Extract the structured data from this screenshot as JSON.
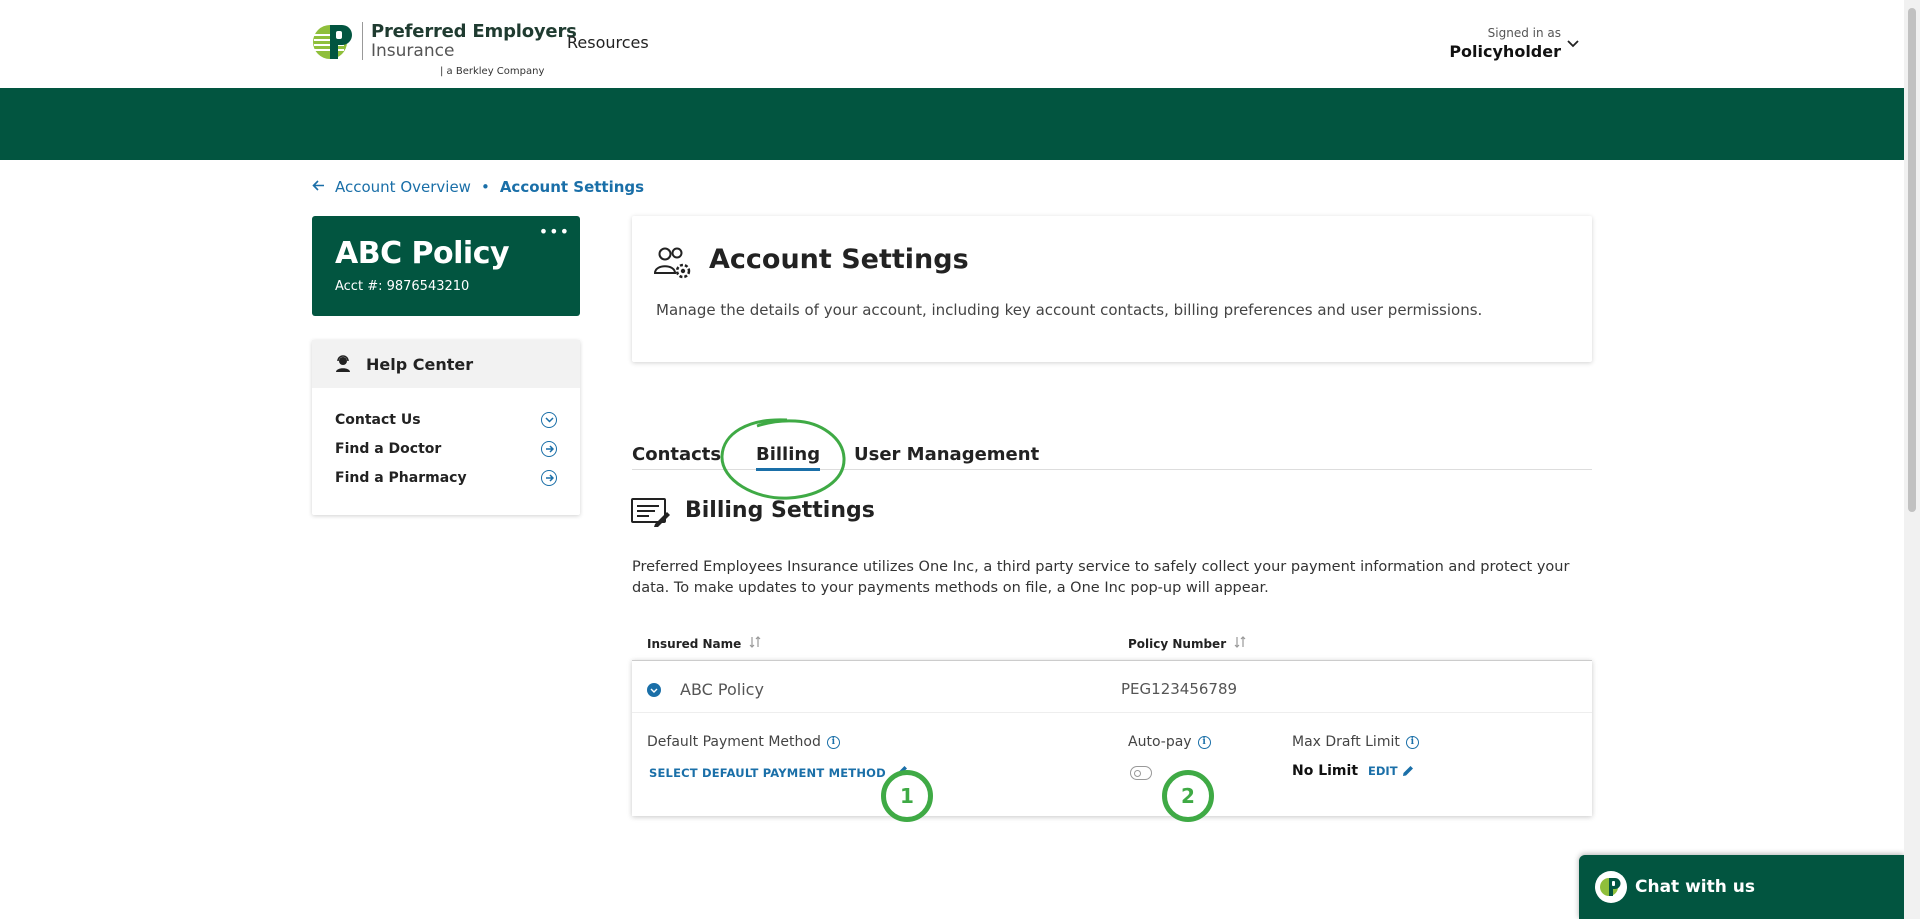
{
  "header": {
    "brand_name": "Preferred Employers",
    "brand_sub": "Insurance",
    "brand_tag": "| a Berkley Company",
    "nav_resources": "Resources",
    "signed_in_label": "Signed in as",
    "signed_in_user": "Policyholder"
  },
  "breadcrumb": {
    "back": "Account Overview",
    "separator": "•",
    "current": "Account Settings"
  },
  "policy_card": {
    "title": "ABC Policy",
    "acct": "Acct #: 9876543210",
    "more": "•••"
  },
  "help_center": {
    "title": "Help Center",
    "items": [
      {
        "label": "Contact Us",
        "icon": "chevron-down-circle-icon"
      },
      {
        "label": "Find a Doctor",
        "icon": "arrow-right-circle-icon"
      },
      {
        "label": "Find a Pharmacy",
        "icon": "arrow-right-circle-icon"
      }
    ]
  },
  "account_settings": {
    "title": "Account Settings",
    "description": "Manage the details of your account, including key account contacts, billing preferences and user permissions."
  },
  "tabs": [
    {
      "label": "Contacts",
      "active": false
    },
    {
      "label": "Billing",
      "active": true
    },
    {
      "label": "User Management",
      "active": false
    }
  ],
  "billing": {
    "title": "Billing Settings",
    "description": "Preferred Employees Insurance utilizes One Inc, a third party service to safely collect your payment information and protect your data. To make updates to your payments methods on file, a One Inc pop-up will appear.",
    "columns": [
      "Insured Name",
      "Policy Number"
    ],
    "row": {
      "name": "ABC Policy",
      "policy_number": "PEG123456789",
      "default_payment_label": "Default Payment Method",
      "select_payment_action": "SELECT DEFAULT PAYMENT METHOD",
      "autopay_label": "Auto-pay",
      "autopay_enabled": false,
      "max_draft_label": "Max Draft Limit",
      "max_draft_value": "No Limit",
      "edit_action": "EDIT"
    }
  },
  "annotations": {
    "marker_1": "1",
    "marker_2": "2"
  },
  "chat": {
    "label": "Chat with us"
  },
  "colors": {
    "brand_green": "#025540",
    "accent_blue": "#1a6fa8",
    "annotation_green": "#3faa45"
  }
}
